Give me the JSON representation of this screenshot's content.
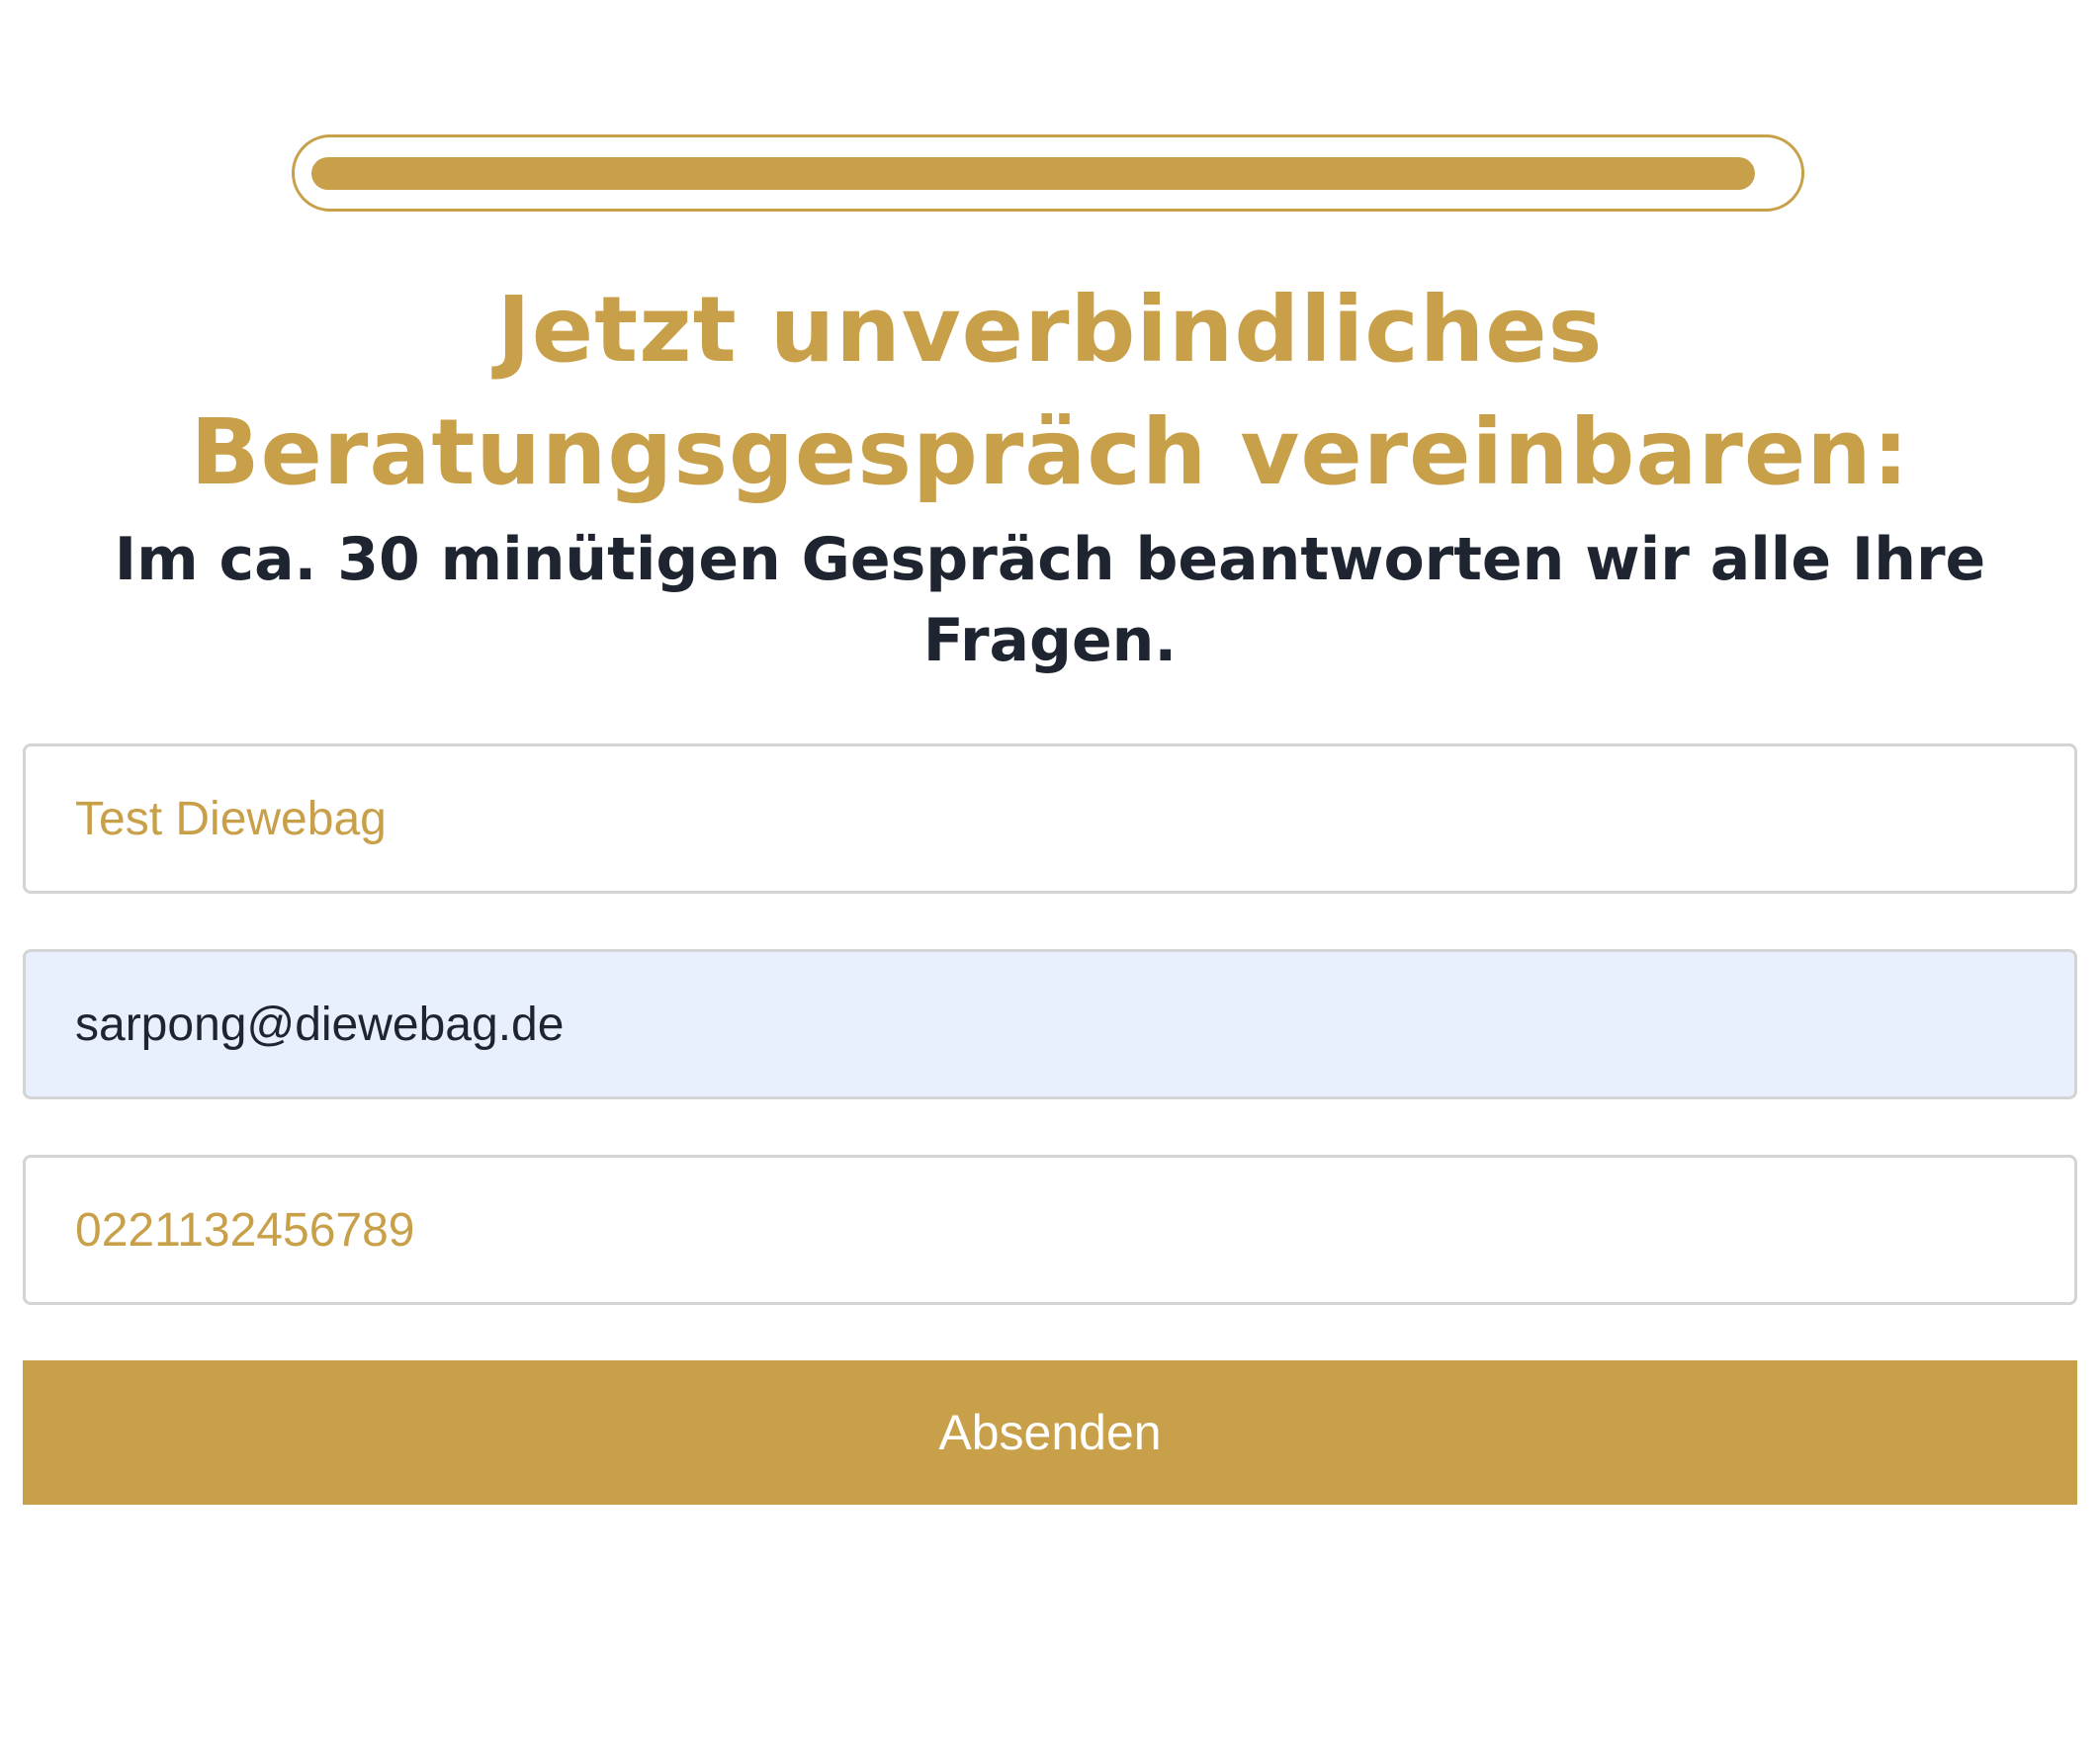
{
  "progress": {
    "fraction": 0.98,
    "color": "#c9a04a"
  },
  "heading": {
    "line1": "Jetzt unverbindliches",
    "line2": "Beratungsgespräch vereinbaren:"
  },
  "subheading": {
    "line1": "Im ca. 30 minütigen Gespräch beantworten wir alle Ihre",
    "line2": "Fragen."
  },
  "form": {
    "name": {
      "value": "",
      "placeholder": "Test Diewebag"
    },
    "email": {
      "value": "sarpong@diewebag.de",
      "placeholder": ""
    },
    "phone": {
      "value": "",
      "placeholder": "0221132456789"
    },
    "submit_label": "Absenden"
  },
  "colors": {
    "accent": "#c9a04a",
    "text": "#1e2430",
    "autofill": "#e8f0fe"
  }
}
